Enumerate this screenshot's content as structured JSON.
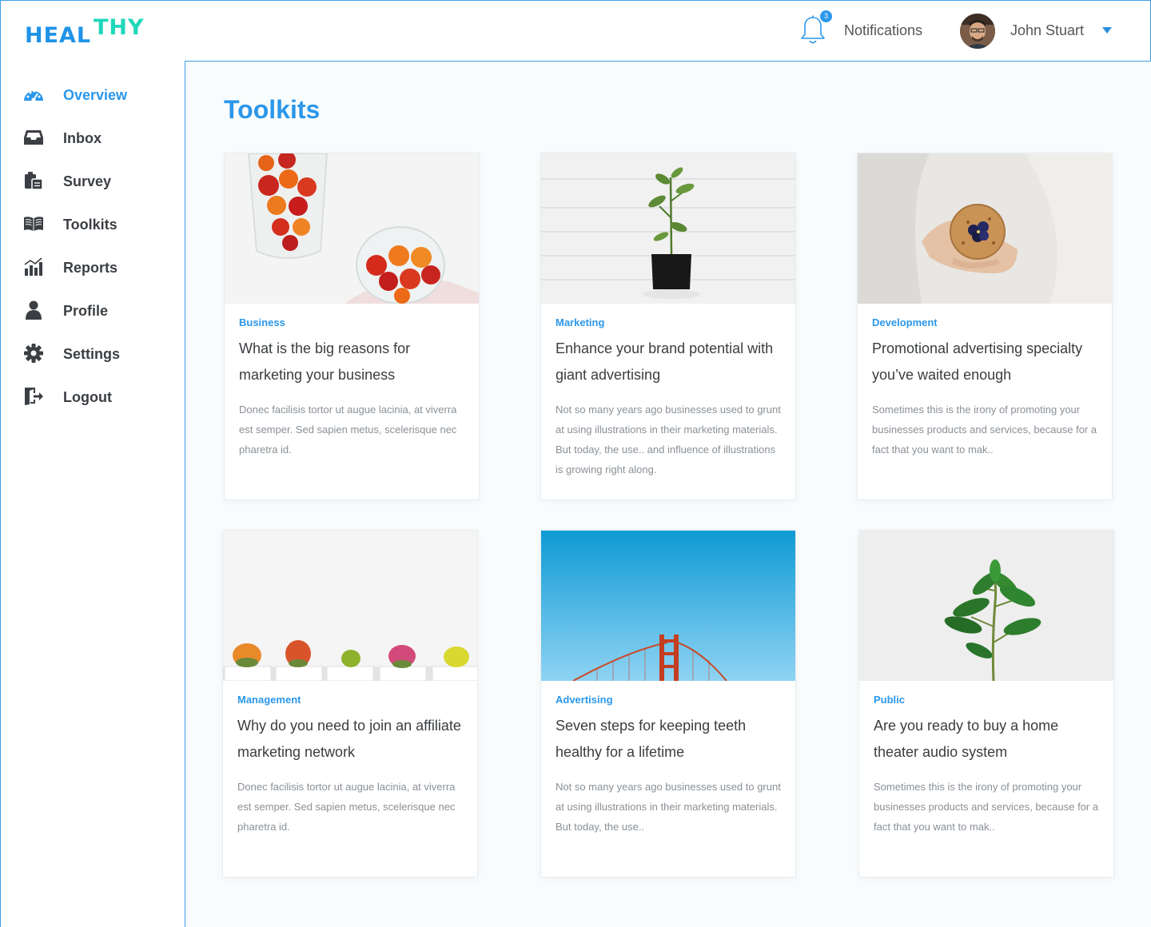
{
  "app": {
    "logo_part1": "HEAL",
    "logo_part2": "THY",
    "brand_blue": "#1f93e8",
    "brand_teal": "#1fd7b9"
  },
  "header": {
    "notifications_label": "Notifications",
    "notifications_count": "3",
    "user_name": "John Stuart"
  },
  "sidebar": {
    "items": [
      {
        "label": "Overview",
        "icon": "dashboard-icon",
        "active": true
      },
      {
        "label": "Inbox",
        "icon": "inbox-icon"
      },
      {
        "label": "Survey",
        "icon": "clipboard-icon"
      },
      {
        "label": "Toolkits",
        "icon": "book-icon"
      },
      {
        "label": "Reports",
        "icon": "bar-chart-icon"
      },
      {
        "label": "Profile",
        "icon": "user-icon"
      },
      {
        "label": "Settings",
        "icon": "gear-icon"
      },
      {
        "label": "Logout",
        "icon": "logout-icon"
      }
    ]
  },
  "main": {
    "title": "Toolkits",
    "cards": [
      {
        "category": "Business",
        "title": "What is the big reasons for marketing your business",
        "description": "Donec facilisis tortor ut augue lacinia, at viverra est semper. Sed sapien metus, scelerisque nec pharetra id.",
        "image": "tomatoes-photo"
      },
      {
        "category": "Marketing",
        "title": "Enhance your brand potential with giant advertising",
        "description": "Not so many years ago businesses used to grunt at using illustrations in their marketing materials. But today, the use.. and influence of  illustrations is growing right along.",
        "image": "plant-pot-photo"
      },
      {
        "category": "Development",
        "title": "Promotional advertising specialty you’ve waited enough",
        "description": "Sometimes this is the irony of promoting your businesses products and services, because for a fact that you want to mak..",
        "image": "cookie-hand-photo"
      },
      {
        "category": "Management",
        "title": "Why do you need to join an affiliate marketing network",
        "description": "Donec facilisis tortor ut augue lacinia, at viverra est semper. Sed sapien metus, scelerisque nec pharetra id.",
        "image": "cacti-photo"
      },
      {
        "category": "Advertising",
        "title": "Seven steps for keeping teeth healthy for a lifetime",
        "description": "Not so many years ago businesses used to grunt at using illustrations in their marketing materials. But today, the use..",
        "image": "bridge-photo"
      },
      {
        "category": "Public",
        "title": "Are you ready to buy a home theater audio system",
        "description": "Sometimes this is the irony of promoting your businesses products and services, because for a fact that you want to mak..",
        "image": "green-plant-photo"
      }
    ]
  }
}
